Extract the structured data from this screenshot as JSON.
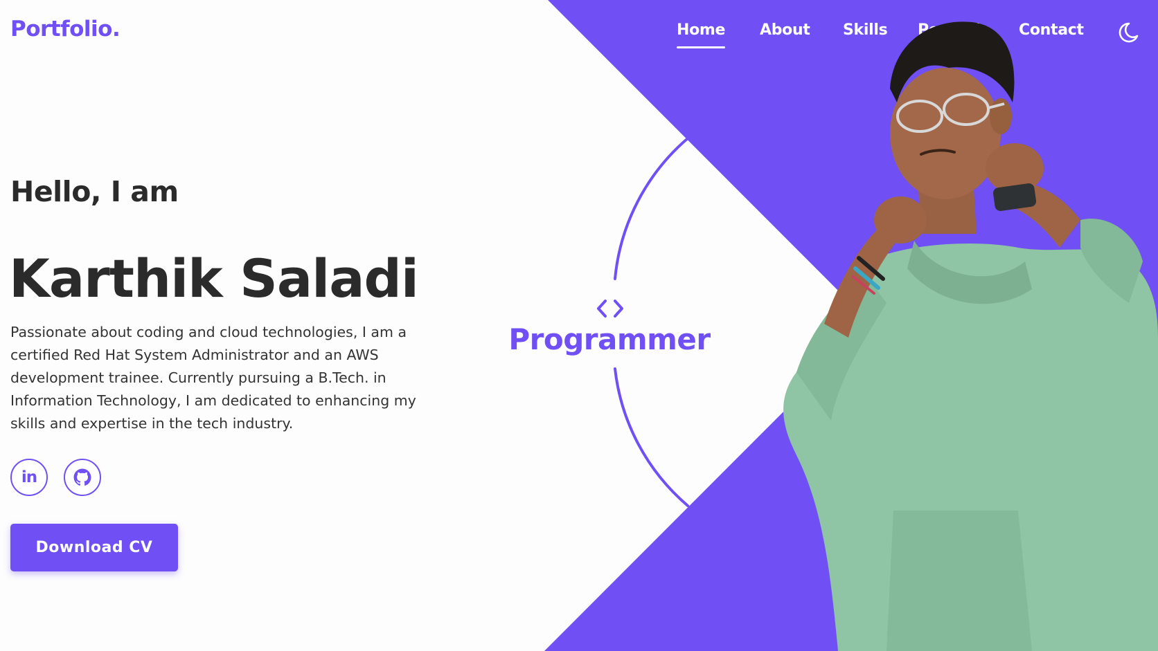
{
  "brand": {
    "logo_text": "Portfolio."
  },
  "nav": {
    "items": [
      {
        "label": "Home",
        "active": true
      },
      {
        "label": "About",
        "active": false
      },
      {
        "label": "Skills",
        "active": false
      },
      {
        "label": "Portfolio",
        "active": false
      },
      {
        "label": "Contact",
        "active": false
      }
    ],
    "theme_toggle_icon": "moon-icon"
  },
  "hero": {
    "greeting": "Hello, I am",
    "name": "Karthik Saladi",
    "description": "Passionate about coding and cloud technologies, I am a certified Red Hat System Administrator and an AWS development trainee. Currently pursuing a B.Tech. in Information Technology, I am dedicated to enhancing my skills and expertise in the tech industry.",
    "social": [
      {
        "icon": "linkedin-icon",
        "glyph": "in"
      },
      {
        "icon": "github-icon"
      }
    ],
    "cv_button_label": "Download CV"
  },
  "role": {
    "icon": "code-brackets-icon",
    "label": "Programmer"
  },
  "colors": {
    "accent": "#7050f4",
    "text": "#2b2b2b",
    "background": "#fdfdfd",
    "hoodie": "#8fc4a4"
  }
}
